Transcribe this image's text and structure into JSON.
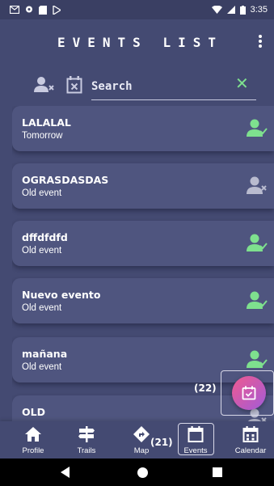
{
  "status_bar": {
    "time": "3:35",
    "left_icons": [
      "gmail-icon",
      "location-icon",
      "sim-icon",
      "play-store-icon"
    ],
    "right_icons": [
      "wifi-icon",
      "signal-icon",
      "battery-icon"
    ]
  },
  "header": {
    "title": "EVENTS LIST",
    "menu_icon": "more-vertical-icon"
  },
  "filters": {
    "user_filter_icon": "user-x-icon",
    "calendar_filter_icon": "calendar-x-icon",
    "search_placeholder": "Search",
    "clear_icon": "close-icon",
    "clear_glyph": "✕"
  },
  "events": [
    {
      "title": "LALALAL",
      "subtitle": "Tomorrow",
      "status_icon": "user-check-icon"
    },
    {
      "title": "OGRASDASDAS",
      "subtitle": "Old event",
      "status_icon": "user-x-icon"
    },
    {
      "title": "dffdfdfd",
      "subtitle": "Old event",
      "status_icon": "user-check-icon"
    },
    {
      "title": "Nuevo evento",
      "subtitle": "Old event",
      "status_icon": "user-check-icon"
    },
    {
      "title": "mañana",
      "subtitle": "Old event",
      "status_icon": "user-check-icon"
    },
    {
      "title": "OLD",
      "subtitle": "",
      "status_icon": "user-x-icon"
    }
  ],
  "fab": {
    "icon": "calendar-check-icon",
    "mark_label": "(22)"
  },
  "bottom_nav": {
    "mark_label": "(21)",
    "items": [
      {
        "label": "Profile",
        "icon": "home-icon"
      },
      {
        "label": "Trails",
        "icon": "signpost-icon"
      },
      {
        "label": "Map",
        "icon": "directions-icon"
      },
      {
        "label": "Events",
        "icon": "calendar-icon"
      },
      {
        "label": "Calendar",
        "icon": "calendar-grid-icon"
      }
    ]
  },
  "colors": {
    "background": "#444a72",
    "card": "#4f557f",
    "accent_green": "#7ee08e",
    "muted_icon": "#b9bbcf",
    "fab_gradient_start": "#f05a8f",
    "fab_gradient_end": "#a15bd8"
  }
}
